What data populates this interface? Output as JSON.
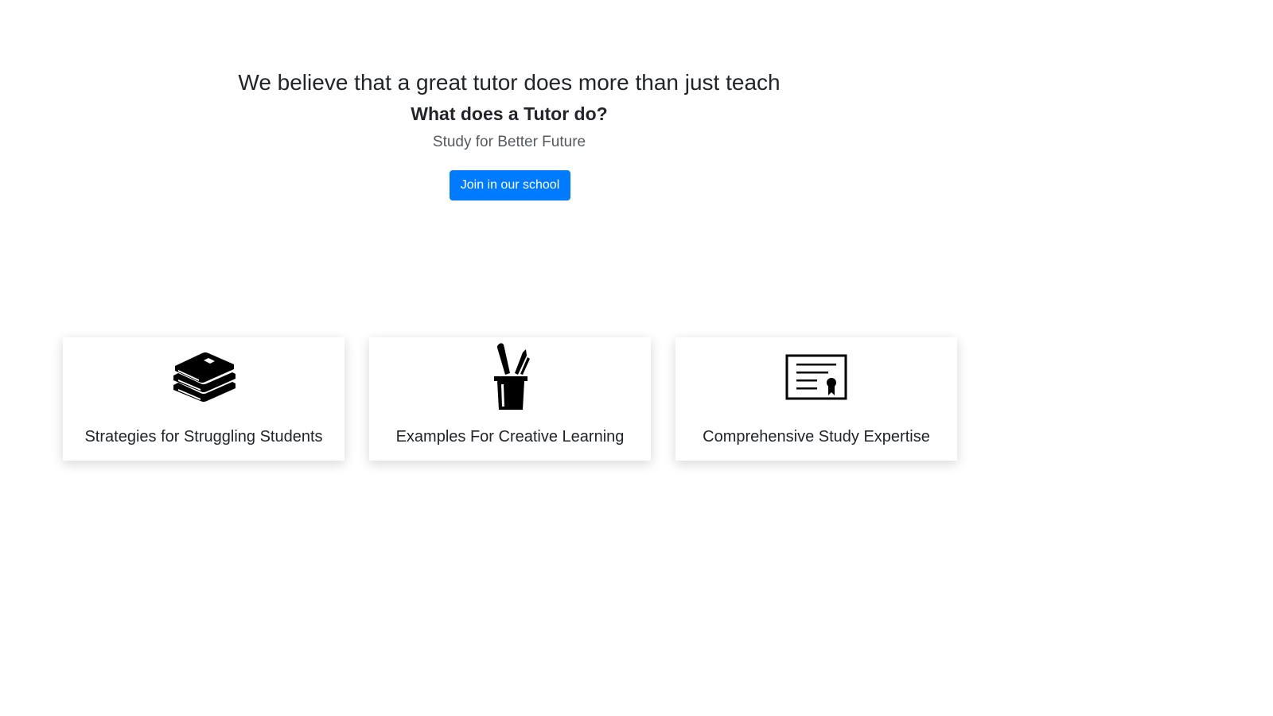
{
  "hero": {
    "title": "We believe that a great tutor does more than just teach",
    "subtitle": "What does a Tutor do?",
    "tagline": "Study for Better Future",
    "join_button_label": "Join in our school"
  },
  "features": [
    {
      "icon": "books-icon",
      "title": "Strategies for Struggling Students"
    },
    {
      "icon": "pencil-cup-icon",
      "title": "Examples For Creative Learning"
    },
    {
      "icon": "certificate-icon",
      "title": "Comprehensive Study Expertise"
    }
  ],
  "colors": {
    "accent": "#007bff",
    "text": "#212529",
    "muted": "#555a5f"
  }
}
